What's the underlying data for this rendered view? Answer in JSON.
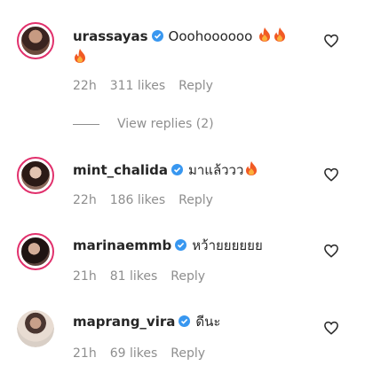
{
  "comments": [
    {
      "username": "urassayas",
      "verified": true,
      "text": "Ooohoooooo",
      "emojis": [
        "fire-icon",
        "fire-icon",
        "fire-icon"
      ],
      "time": "22h",
      "likes": "311 likes",
      "reply": "Reply",
      "view_replies": "View replies (2)"
    },
    {
      "username": "mint_chalida",
      "verified": true,
      "text": "มาแล้ววว",
      "emojis": [
        "fire-icon"
      ],
      "time": "22h",
      "likes": "186 likes",
      "reply": "Reply"
    },
    {
      "username": "marinaemmb",
      "verified": true,
      "text": "หว้ายยยยยย",
      "emojis": [],
      "time": "21h",
      "likes": "81 likes",
      "reply": "Reply"
    },
    {
      "username": "maprang_vira",
      "verified": true,
      "text": "ดีนะ",
      "emojis": [],
      "time": "21h",
      "likes": "69 likes",
      "reply": "Reply"
    }
  ],
  "colors": {
    "text": "#262626",
    "secondary": "#8e8e8e",
    "verified": "#3897f0",
    "story_ring": "#e1306c"
  }
}
